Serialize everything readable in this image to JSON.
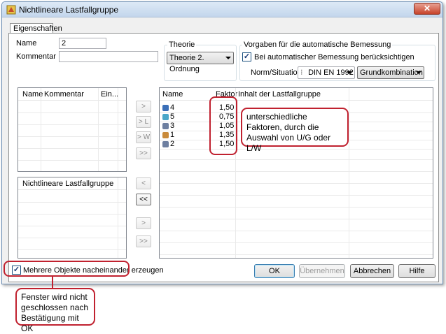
{
  "window": {
    "title": "Nichtlineare Lastfallgruppe",
    "close": "✕"
  },
  "tabs": [
    {
      "label": "Eigenschaften"
    }
  ],
  "form": {
    "name_label": "Name",
    "name_value": "2",
    "comment_label": "Kommentar",
    "comment_value": ""
  },
  "theorie": {
    "group_title": "Theorie",
    "selected": "Theorie 2. Ordnung"
  },
  "bemessung": {
    "group_title": "Vorgaben für die automatische Bemessung",
    "checkbox_label": "Bei automatischer Bemessung berücksichtigen",
    "checked": true,
    "norm_label": "Norm/Situation:",
    "norm_value": "DIN EN 1992",
    "situation_value": "Grundkombination"
  },
  "left_list": {
    "headers": [
      "Name",
      "Kommentar",
      "Ein..."
    ]
  },
  "left_group_list": {
    "header": "Nichtlineare Lastfallgruppe"
  },
  "transfer_buttons": {
    "add": ">",
    "add_l": "> L",
    "add_w": "> W",
    "add_all": ">>",
    "remove": "<",
    "remove_all": "<<",
    "bottom_add": ">",
    "bottom_add_all": ">>"
  },
  "right_list": {
    "headers": [
      "Name",
      "Faktor",
      "Inhalt der Lastfallgruppe"
    ],
    "rows": [
      {
        "name": "4",
        "factor": "1,50",
        "icon": "snow-load-icon",
        "color": "#3b6fb8"
      },
      {
        "name": "5",
        "factor": "0,75",
        "icon": "wind-load-icon",
        "color": "#4aa7c9"
      },
      {
        "name": "3",
        "factor": "1,05",
        "icon": "traffic-load-icon",
        "color": "#6d7fa0"
      },
      {
        "name": "1",
        "factor": "1,35",
        "icon": "dead-load-icon",
        "color": "#c98a3a"
      },
      {
        "name": "2",
        "factor": "1,50",
        "icon": "live-load-icon",
        "color": "#6d7fa0"
      }
    ]
  },
  "footer": {
    "multi_checkbox_label": "Mehrere Objekte nacheinander erzeugen",
    "multi_checked": true,
    "ok": "OK",
    "apply": "Übernehmen",
    "cancel": "Abbrechen",
    "help": "Hilfe"
  },
  "annotations": {
    "factors_note": "unterschiedliche Faktoren, durch die Auswahl von U/G oder L/W",
    "window_note": "Fenster wird nicht geschlossen nach Bestätigung mit OK"
  },
  "colors": {
    "annotation_red": "#c0212f",
    "title_bar": "#c3d6ec"
  }
}
